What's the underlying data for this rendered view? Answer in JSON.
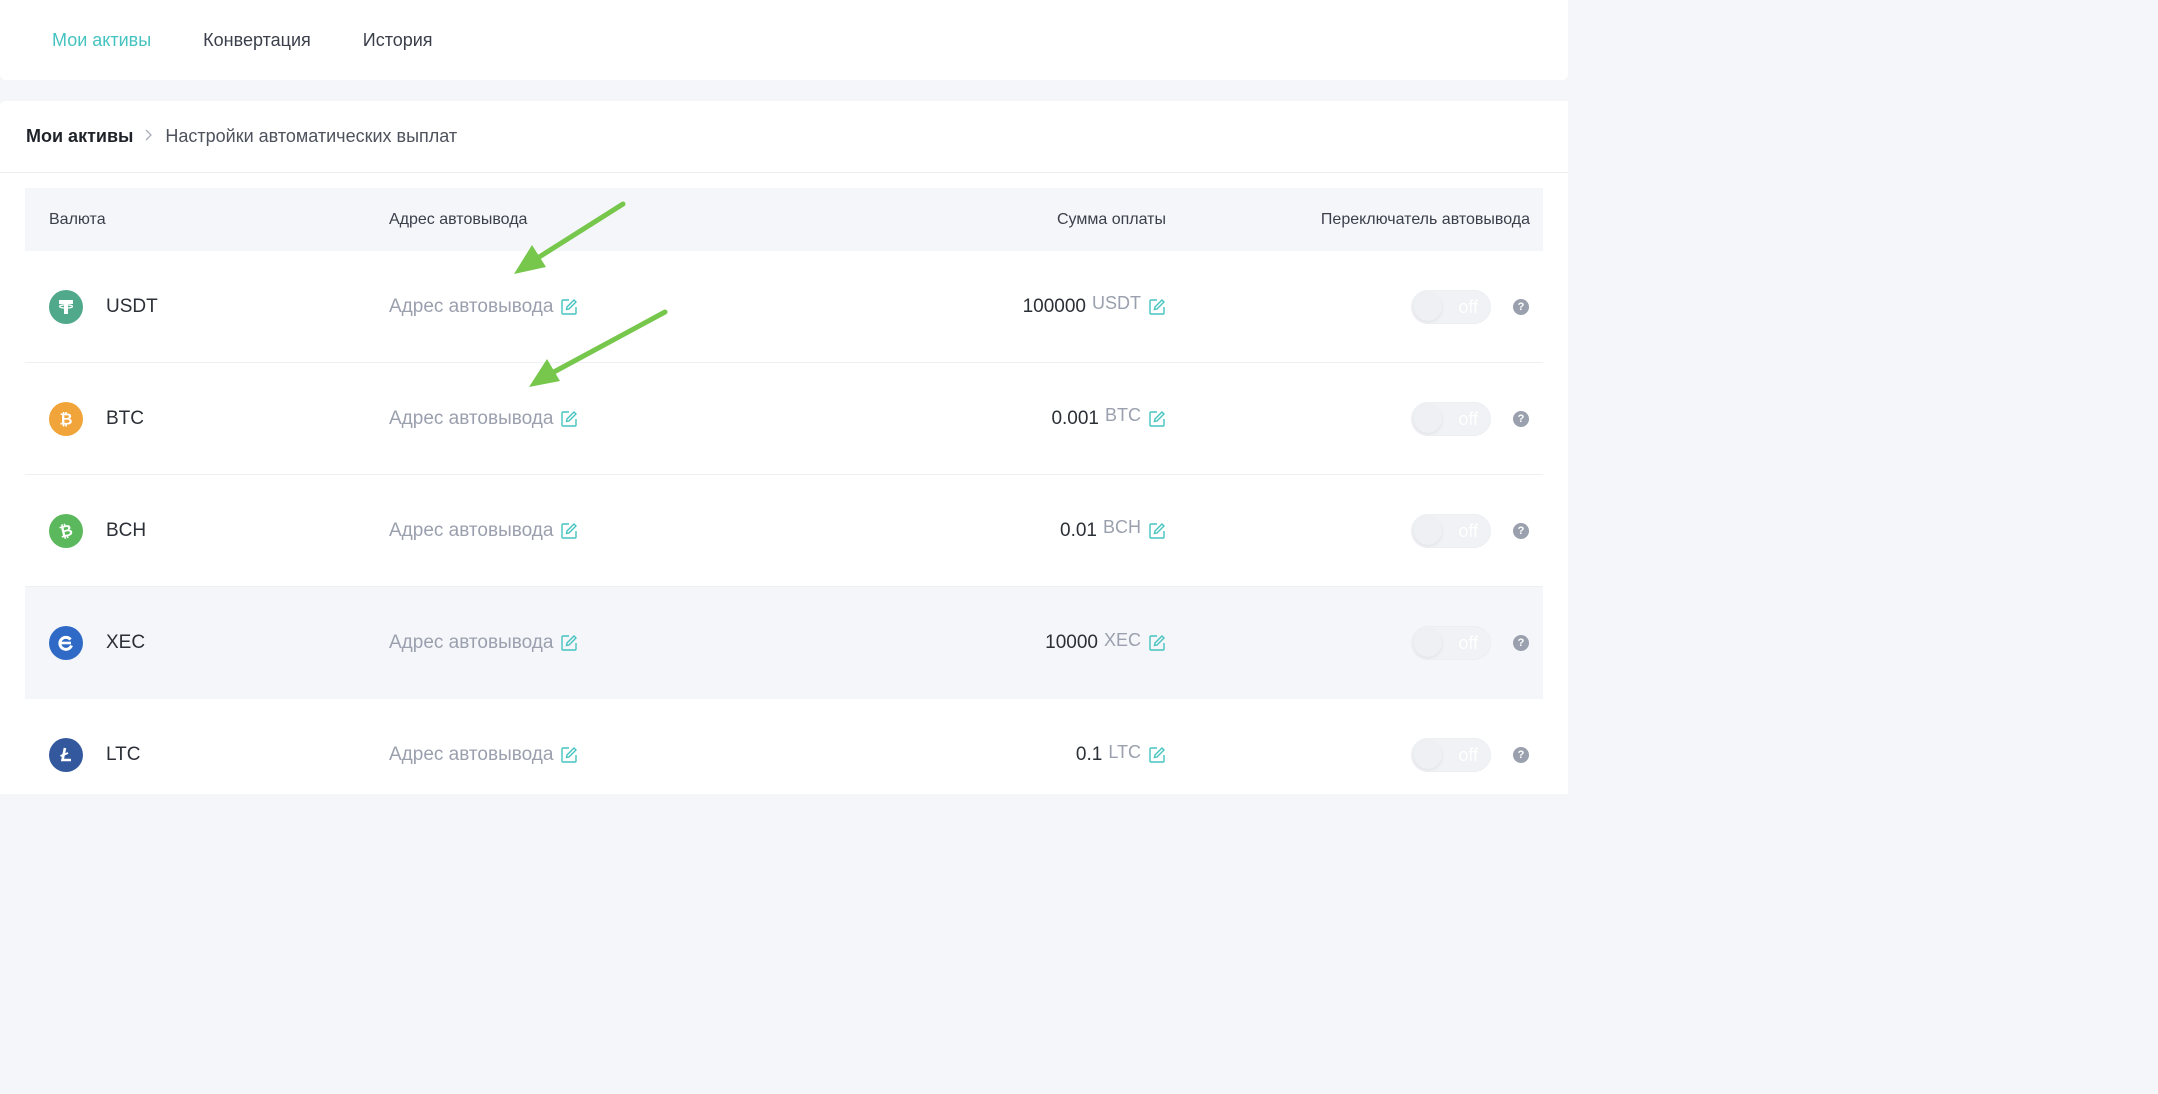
{
  "topnav": {
    "tabs": [
      {
        "label": "Мои активы",
        "active": true
      },
      {
        "label": "Конвертация",
        "active": false
      },
      {
        "label": "История",
        "active": false
      }
    ]
  },
  "breadcrumb": {
    "root": "Мои активы",
    "current": "Настройки автоматических выплат"
  },
  "table": {
    "headers": {
      "currency": "Валюта",
      "address": "Адрес автовывода",
      "amount": "Сумма оплаты",
      "switch": "Переключатель автовывода"
    },
    "rows": [
      {
        "coin": "USDT",
        "icon": "tether-icon",
        "color": "#50a98a",
        "address_placeholder": "Адрес автовывода",
        "amount": "100000",
        "unit": "USDT",
        "toggle": "off",
        "help": "?"
      },
      {
        "coin": "BTC",
        "icon": "bitcoin-icon",
        "color": "#f0a43a",
        "address_placeholder": "Адрес автовывода",
        "amount": "0.001",
        "unit": "BTC",
        "toggle": "off",
        "help": "?"
      },
      {
        "coin": "BCH",
        "icon": "bitcoin-cash-icon",
        "color": "#5cb85c",
        "address_placeholder": "Адрес автовывода",
        "amount": "0.01",
        "unit": "BCH",
        "toggle": "off",
        "help": "?"
      },
      {
        "coin": "XEC",
        "icon": "ecash-icon",
        "color": "#2f6bc6",
        "address_placeholder": "Адрес автовывода",
        "amount": "10000",
        "unit": "XEC",
        "toggle": "off",
        "help": "?"
      },
      {
        "coin": "LTC",
        "icon": "litecoin-icon",
        "color": "#34589e",
        "address_placeholder": "Адрес автовывода",
        "amount": "0.1",
        "unit": "LTC",
        "toggle": "off",
        "help": "?"
      }
    ]
  },
  "colors": {
    "accent": "#45c3c0",
    "arrow": "#76c74c"
  }
}
